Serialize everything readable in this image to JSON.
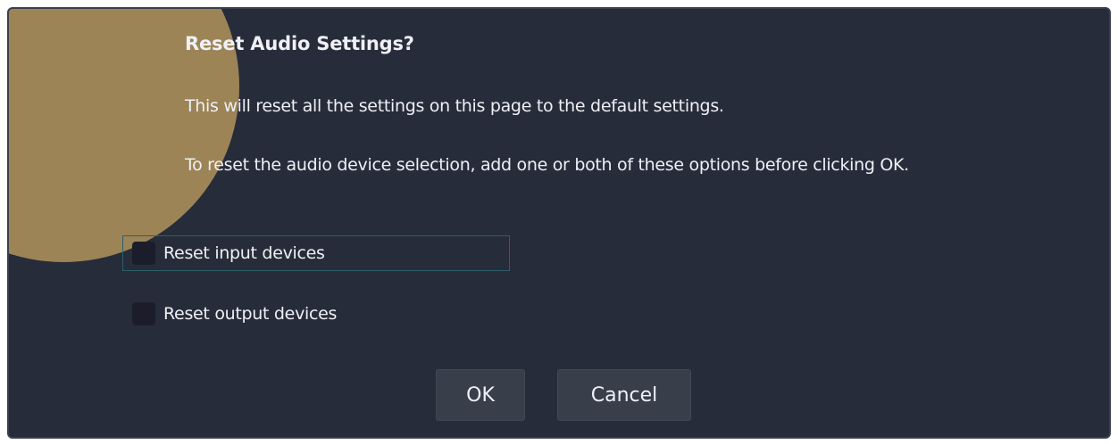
{
  "dialog": {
    "icon": "question-mark-icon",
    "icon_glyph": "?",
    "title": "Reset Audio Settings?",
    "message_line1": "This will reset all the settings on this page to the default settings.",
    "message_line2": "To reset the audio device selection, add one or both of these options before clicking OK.",
    "options": [
      {
        "label": "Reset input devices",
        "checked": false,
        "focused": true
      },
      {
        "label": "Reset output devices",
        "checked": false,
        "focused": false
      }
    ],
    "buttons": {
      "ok_label": "OK",
      "cancel_label": "Cancel"
    },
    "colors": {
      "background": "#272c3a",
      "icon_badge": "#9c8457",
      "button": "#393e4b",
      "focus_outline": "#2d5f68"
    }
  }
}
